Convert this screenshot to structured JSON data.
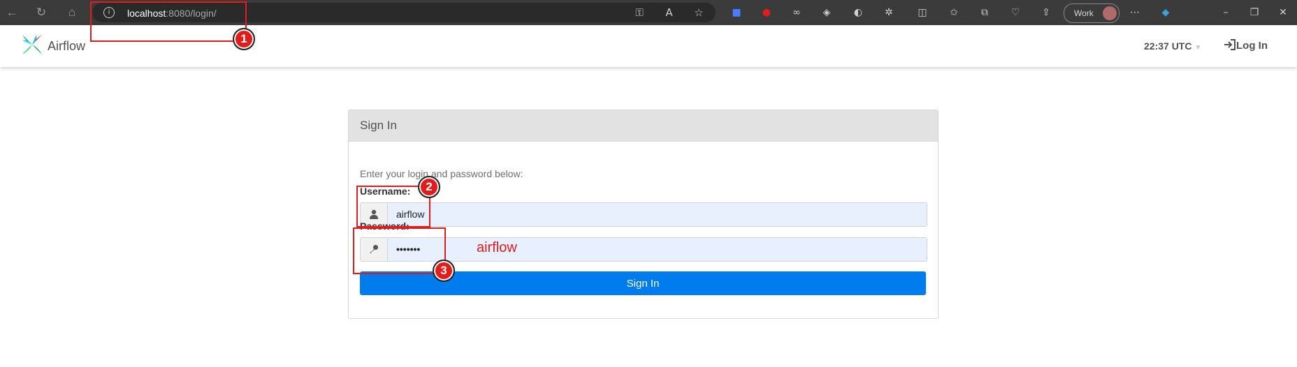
{
  "browser": {
    "url_host": "localhost",
    "url_rest": ":8080/login/",
    "profile_label": "Work"
  },
  "navbar": {
    "brand": "Airflow",
    "clock": "22:37 UTC",
    "login_label": "Log In"
  },
  "panel": {
    "title": "Sign In",
    "hint": "Enter your login and password below:",
    "username_label": "Username:",
    "username_value": "airflow",
    "password_label": "Password:",
    "password_value": "•••••••",
    "submit_label": "Sign In"
  },
  "annotations": {
    "badge1": "1",
    "badge2": "2",
    "badge3": "3",
    "password_note": "airflow",
    "color": "#e31b1b"
  },
  "colors": {
    "primary": "#017cee",
    "autofill": "#e8f0fe"
  }
}
